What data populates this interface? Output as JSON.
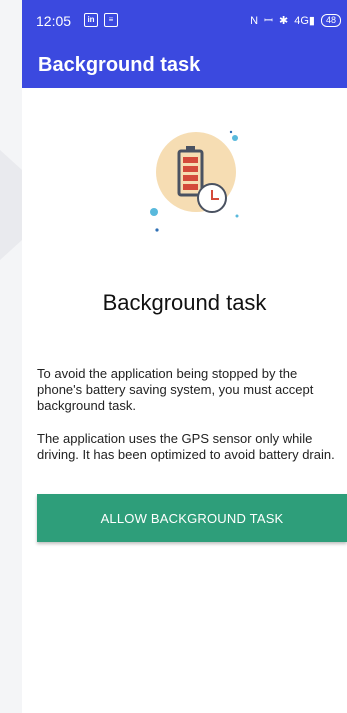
{
  "status_bar": {
    "time": "12:05",
    "left_icons": [
      "linkedin-icon",
      "messages-icon"
    ],
    "right_icons": [
      "nfc-icon",
      "mute-icon",
      "bluetooth-icon",
      "signal-icon"
    ],
    "network_label": "4G",
    "battery_level": "48"
  },
  "app_bar": {
    "title": "Background task"
  },
  "content": {
    "illustration_icon": "battery-clock-icon",
    "heading": "Background task",
    "paragraph_1": "To avoid the application being stopped by the phone's battery saving system, you must accept background task.",
    "paragraph_2": "The application uses the GPS sensor only while driving. It has been optimized to avoid battery drain.",
    "allow_button_label": "Allow background task"
  },
  "colors": {
    "app_bar": "#3b49df",
    "button": "#2e9e7a",
    "illustration_circle": "#f6ddb3",
    "battery_red": "#d44a3a"
  }
}
